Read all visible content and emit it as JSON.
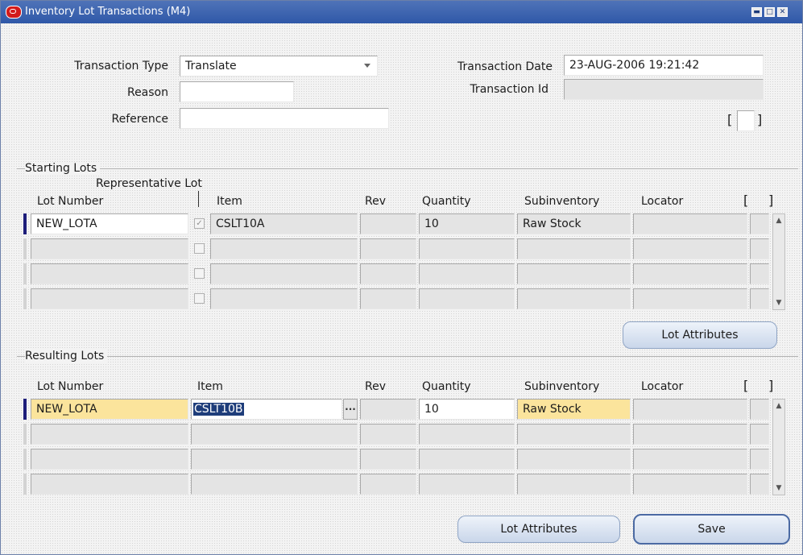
{
  "window": {
    "title": "Inventory Lot Transactions (M4)",
    "buttons": [
      "minimize",
      "maximize",
      "close"
    ]
  },
  "header": {
    "transaction_type_label": "Transaction Type",
    "transaction_type_value": "Translate",
    "reason_label": "Reason",
    "reason_value": "",
    "reference_label": "Reference",
    "reference_value": "",
    "transaction_date_label": "Transaction Date",
    "transaction_date_value": "23-AUG-2006 19:21:42",
    "transaction_id_label": "Transaction Id",
    "transaction_id_value": "",
    "bracket_open": "[",
    "bracket_close": "]"
  },
  "starting_lots": {
    "section_label": "Starting Lots",
    "representative_lot_label": "Representative Lot",
    "columns": [
      "Lot Number",
      "Item",
      "Rev",
      "Quantity",
      "Subinventory",
      "Locator"
    ],
    "bracket_open": "[",
    "bracket_close": "]",
    "rows": [
      {
        "lot": "NEW_LOTA",
        "representative": true,
        "item": "CSLT10A",
        "rev": "",
        "qty": "10",
        "subinv": "Raw Stock",
        "locator": ""
      },
      {
        "lot": "",
        "representative": false,
        "item": "",
        "rev": "",
        "qty": "",
        "subinv": "",
        "locator": ""
      },
      {
        "lot": "",
        "representative": false,
        "item": "",
        "rev": "",
        "qty": "",
        "subinv": "",
        "locator": ""
      },
      {
        "lot": "",
        "representative": false,
        "item": "",
        "rev": "",
        "qty": "",
        "subinv": "",
        "locator": ""
      }
    ],
    "lot_attributes_button": "Lot Attributes"
  },
  "resulting_lots": {
    "section_label": "Resulting Lots",
    "columns": [
      "Lot Number",
      "Item",
      "Rev",
      "Quantity",
      "Subinventory",
      "Locator"
    ],
    "bracket_open": "[",
    "bracket_close": "]",
    "rows": [
      {
        "lot": "NEW_LOTA",
        "item": "CSLT10B",
        "rev": "",
        "qty": "10",
        "subinv": "Raw Stock",
        "locator": ""
      },
      {
        "lot": "",
        "item": "",
        "rev": "",
        "qty": "",
        "subinv": "",
        "locator": ""
      },
      {
        "lot": "",
        "item": "",
        "rev": "",
        "qty": "",
        "subinv": "",
        "locator": ""
      },
      {
        "lot": "",
        "item": "",
        "rev": "",
        "qty": "",
        "subinv": "",
        "locator": ""
      }
    ],
    "lov_button": "...",
    "lot_attributes_button": "Lot Attributes",
    "save_button": "Save"
  },
  "colors": {
    "titlebar": "#2f58a8",
    "required_field": "#fbe49c",
    "selection": "#1e3d7a",
    "current_row_marker": "#1e1e7a"
  }
}
